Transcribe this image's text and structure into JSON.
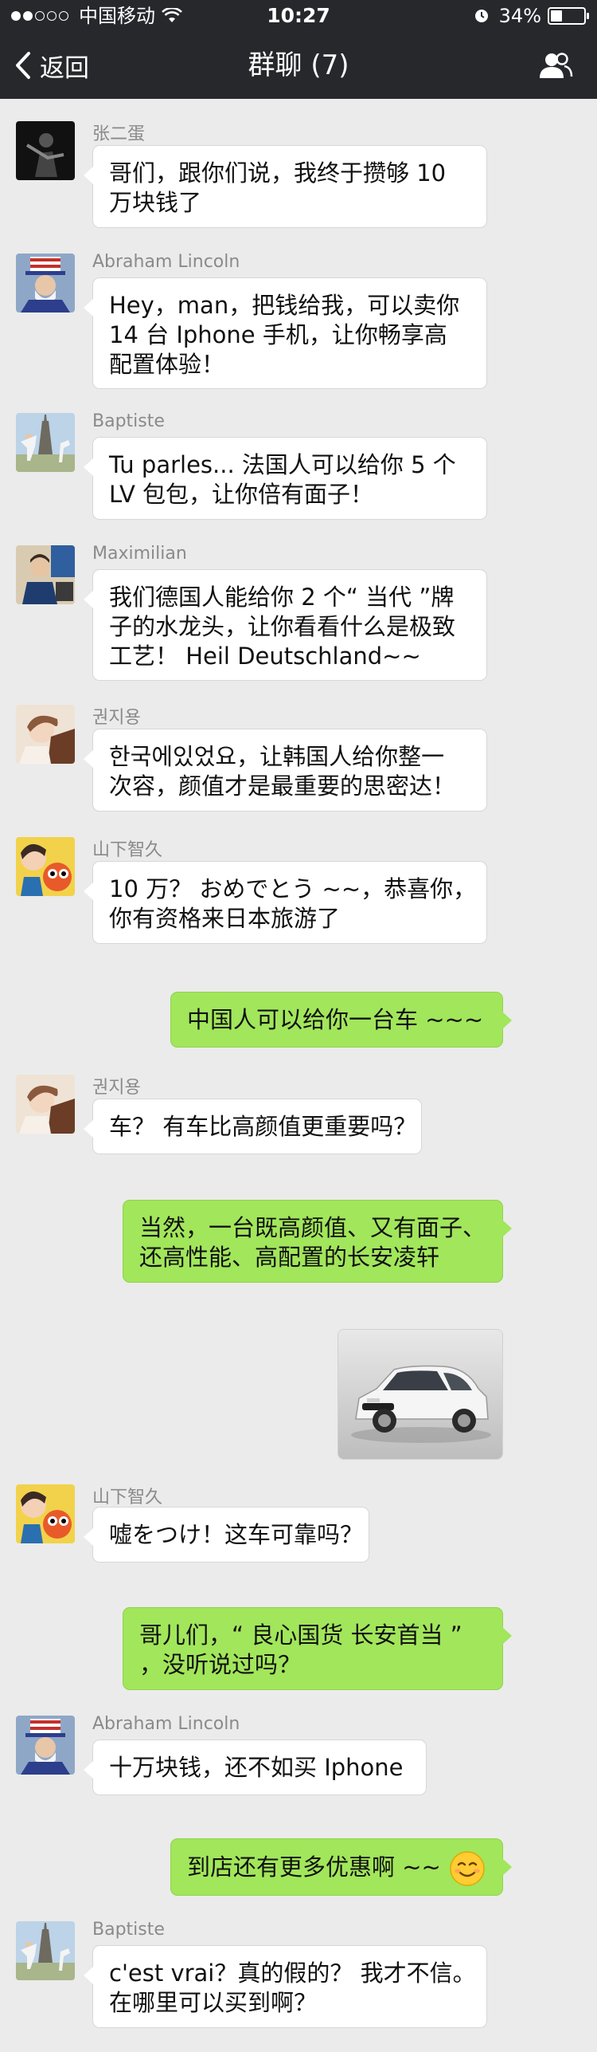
{
  "status_bar": {
    "carrier": "中国移动",
    "time": "10:27",
    "battery": "34%",
    "battery_level": 0.34,
    "signal_bars": 2
  },
  "nav": {
    "back_label": "返回",
    "title": "群聊 (7)",
    "back_icon": "chevron-left-icon",
    "members_icon": "group-members-icon"
  },
  "colors": {
    "nav_bg": "#27282c",
    "chat_bg": "#ebebeb",
    "incoming_bubble": "#ffffff",
    "outgoing_bubble": "#a2e65b"
  },
  "messages": [
    {
      "sender": "张二蛋",
      "lines": [
        "哥们，跟你们说，我终于攒够 10",
        "万块钱了"
      ]
    },
    {
      "sender": "Abraham Lincoln",
      "lines": [
        "Hey，man，把钱给我，可以卖你",
        "14 台 Iphone 手机，让你畅享高",
        "配置体验！"
      ]
    },
    {
      "sender": "Baptiste",
      "lines": [
        "Tu parles... 法国人可以给你 5 个",
        "LV 包包，让你倍有面子！"
      ]
    },
    {
      "sender": "Maximilian",
      "lines": [
        "我们德国人能给你 2 个“ 当代 ”牌",
        "子的水龙头，让你看看什么是极致",
        "工艺！ Heil Deutschland~~"
      ]
    },
    {
      "sender": "권지용",
      "lines": [
        "한국에있었요，让韩国人给你整一",
        "次容，颜值才是最重要的思密达！"
      ]
    },
    {
      "sender": "山下智久",
      "lines": [
        "10 万？ おめでとう ~~，恭喜你，",
        "你有资格来日本旅游了"
      ]
    },
    {
      "sender": "me",
      "lines": [
        "中国人可以给你一台车 ~~~"
      ]
    },
    {
      "sender": "권지용",
      "lines": [
        "车？ 有车比高颜值更重要吗？"
      ]
    },
    {
      "sender": "me",
      "lines": [
        "当然，一台既高颜值、又有面子、",
        "还高性能、高配置的长安凌轩"
      ]
    },
    {
      "sender": "me",
      "image": "white-suv-car-photo"
    },
    {
      "sender": "山下智久",
      "lines": [
        "嘘をつけ！这车可靠吗？"
      ]
    },
    {
      "sender": "me",
      "lines": [
        "哥儿们，“ 良心国货 长安首当 ”",
        "，没听说过吗？"
      ]
    },
    {
      "sender": "Abraham Lincoln",
      "lines": [
        "十万块钱，还不如买 Iphone"
      ]
    },
    {
      "sender": "me",
      "lines": [
        "到店还有更多优惠啊 ~~"
      ],
      "emoji": "smiling-face-emoji"
    },
    {
      "sender": "Baptiste",
      "lines": [
        "c'est vrai？真的假的？ 我才不信。",
        "在哪里可以买到啊？"
      ]
    }
  ]
}
